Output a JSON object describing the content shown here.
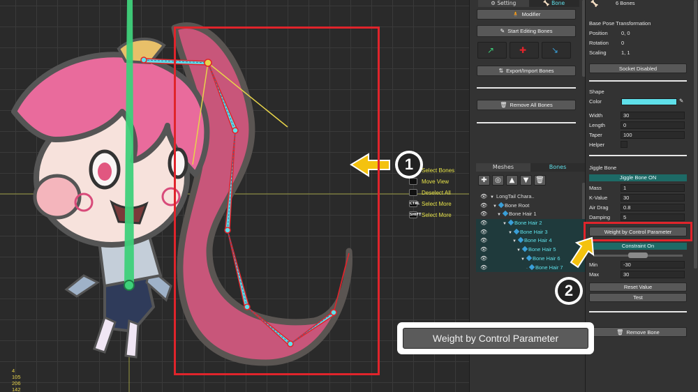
{
  "viewport": {
    "key_legend": [
      {
        "key": "",
        "label": "Select Bones"
      },
      {
        "key": "",
        "label": "Move View"
      },
      {
        "key": "",
        "label": "Deselect All"
      },
      {
        "key": "CTRL",
        "label": "Select More"
      },
      {
        "key": "SHIFT",
        "label": "Select More"
      }
    ],
    "stats": [
      "4",
      "105",
      "206",
      "142"
    ]
  },
  "mid": {
    "tabs": [
      "Setting",
      "Bone"
    ],
    "modifier_label": "Modifier",
    "start_editing_label": "Start Editing Bones",
    "export_import_label": "Export/Import Bones",
    "remove_all_label": "Remove All Bones",
    "sub_tabs": [
      "Meshes",
      "Bones"
    ],
    "tree": [
      {
        "label": "LongTail Chara..",
        "depth": 0,
        "cyan": false
      },
      {
        "label": "Bone Root",
        "depth": 1,
        "cyan": false
      },
      {
        "label": "Bone Hair 1",
        "depth": 2,
        "cyan": false
      },
      {
        "label": "Bone Hair 2",
        "depth": 3,
        "cyan": true
      },
      {
        "label": "Bone Hair 3",
        "depth": 4,
        "cyan": true
      },
      {
        "label": "Bone Hair 4",
        "depth": 5,
        "cyan": true
      },
      {
        "label": "Bone Hair 5",
        "depth": 6,
        "cyan": true
      },
      {
        "label": "Bone Hair 6",
        "depth": 7,
        "cyan": true
      },
      {
        "label": "Bone Hair 7",
        "depth": 8,
        "cyan": true
      }
    ]
  },
  "right": {
    "bones_count": "6 Bones",
    "base_pose_title": "Base Pose Transformation",
    "position_label": "Position",
    "position_value": "0, 0",
    "rotation_label": "Rotation",
    "rotation_value": "0",
    "scaling_label": "Scaling",
    "scaling_value": "1, 1",
    "socket_label": "Socket Disabled",
    "shape_title": "Shape",
    "color_label": "Color",
    "width_label": "Width",
    "width_value": "30",
    "length_label": "Length",
    "length_value": "0",
    "taper_label": "Taper",
    "taper_value": "100",
    "helper_label": "Helper",
    "jiggle_title": "Jiggle Bone",
    "jiggle_on": "Jiggle Bone ON",
    "mass_label": "Mass",
    "mass_value": "1",
    "kvalue_label": "K-Value",
    "kvalue_value": "30",
    "airdrag_label": "Air Drag",
    "airdrag_value": "0.8",
    "damping_label": "Damping",
    "damping_value": "5",
    "weight_button": "Weight by Control Parameter",
    "constraint_on": "Constraint On",
    "min_label": "Min",
    "min_value": "-30",
    "max_label": "Max",
    "max_value": "30",
    "reset_label": "Reset Value",
    "test_label": "Test",
    "remove_bone_label": "Remove Bone"
  },
  "callout": {
    "weight_button": "Weight by Control Parameter",
    "badge1": "1",
    "badge2": "2"
  },
  "colors": {
    "accent": "#5fe0ea",
    "highlight_red": "#e0242b",
    "arrow_yellow": "#f4c20f",
    "banner_teal": "#1d6a66"
  }
}
